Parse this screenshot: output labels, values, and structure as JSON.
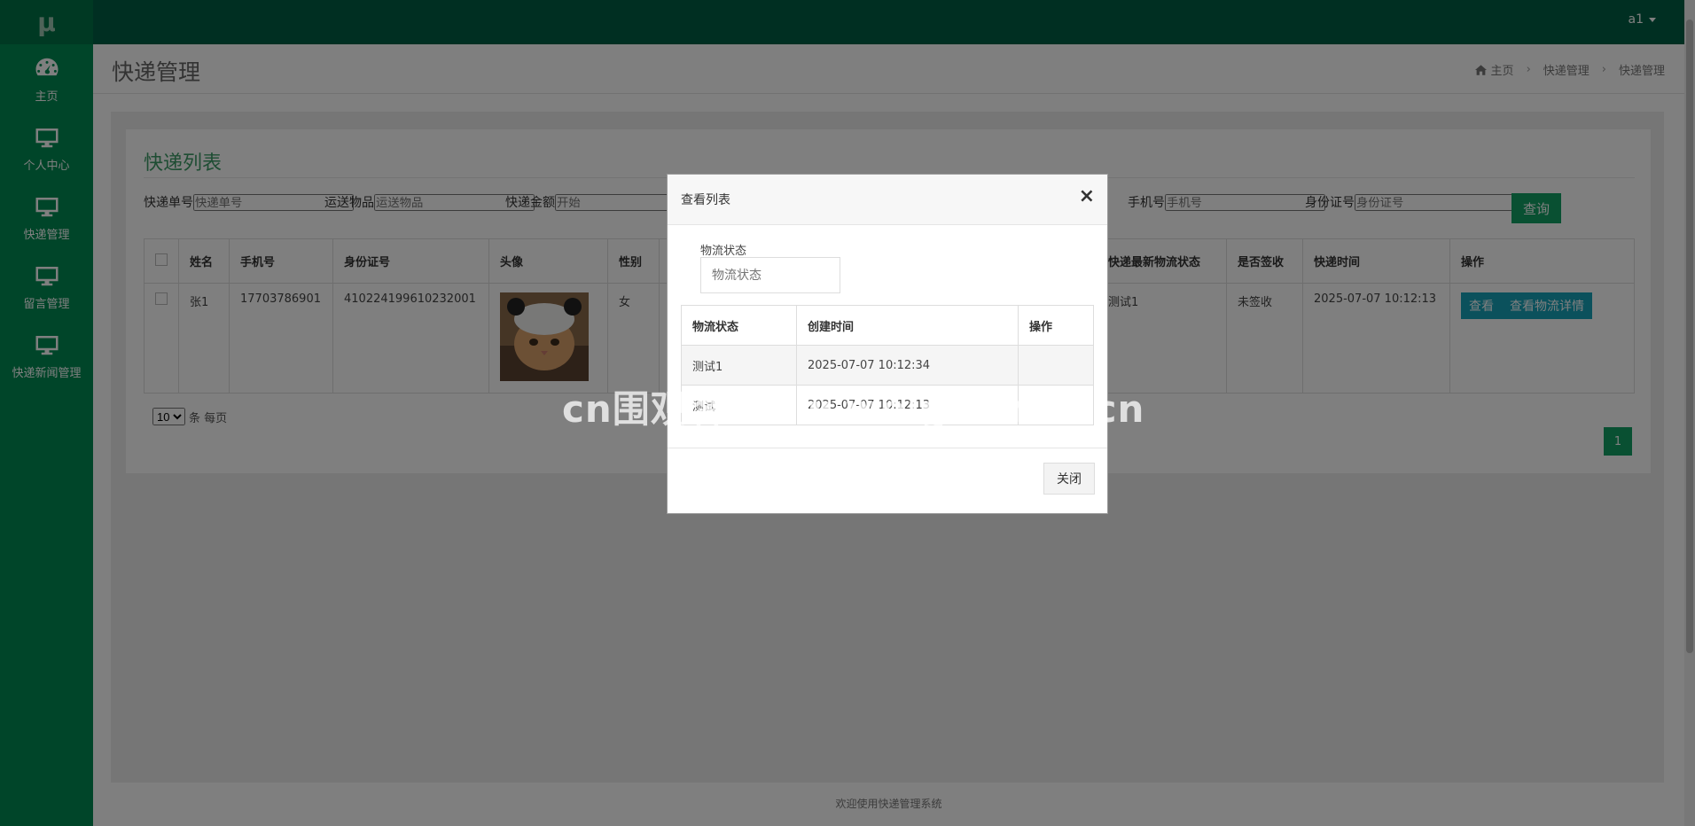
{
  "app": {
    "logo": "μ",
    "user": "a1",
    "footer": "欢迎使用快递管理系统"
  },
  "sidebar": {
    "items": [
      {
        "label": "主页",
        "icon": "dashboard-icon"
      },
      {
        "label": "个人中心",
        "icon": "monitor-icon"
      },
      {
        "label": "快递管理",
        "icon": "monitor-icon"
      },
      {
        "label": "留言管理",
        "icon": "monitor-icon"
      },
      {
        "label": "快递新闻管理",
        "icon": "monitor-icon"
      }
    ]
  },
  "header": {
    "title": "快递管理",
    "breadcrumb": [
      "主页",
      "快递管理",
      "快递管理"
    ]
  },
  "panel": {
    "title": "快递列表",
    "search": {
      "order_label": "快递单号",
      "order_placeholder": "快递单号",
      "goods_label": "运送物品",
      "goods_placeholder": "运送物品",
      "amount_label": "快递金额",
      "amount_placeholder": "开始",
      "phone_label": "手机号",
      "phone_placeholder": "手机号",
      "id_label": "身份证号",
      "id_placeholder": "身份证号",
      "button": "查询"
    },
    "table": {
      "headers": [
        "姓名",
        "手机号",
        "身份证号",
        "头像",
        "性别",
        "快递最新物流状态",
        "是否签收",
        "快递时间",
        "操作"
      ],
      "rows": [
        {
          "name": "张1",
          "phone": "17703786901",
          "id_number": "410224199610232001",
          "gender": "女",
          "latest_status": "测试1",
          "signed": "未签收",
          "time": "2025-07-07 10:12:13",
          "btn_view": "查看",
          "btn_detail": "查看物流详情"
        }
      ]
    },
    "page_size": "10",
    "page_size_suffix": "条 每页",
    "current_page": "1"
  },
  "modal": {
    "title": "查看列表",
    "close_symbol": "×",
    "field_label": "物流状态",
    "field_placeholder": "物流状态",
    "table": {
      "headers": [
        "物流状态",
        "创建时间",
        "操作"
      ],
      "rows": [
        {
          "status": "测试1",
          "time": "2025-07-07 10:12:34"
        },
        {
          "status": "测试",
          "time": "2025-07-07 10:12:13"
        }
      ]
    },
    "close_button": "关闭"
  },
  "watermark": "cn围观客www.weiguanke.cn",
  "colors": {
    "sidebar": "#008a52",
    "topbar": "#005f44",
    "accent": "#12a064",
    "info": "#17a2b8"
  }
}
